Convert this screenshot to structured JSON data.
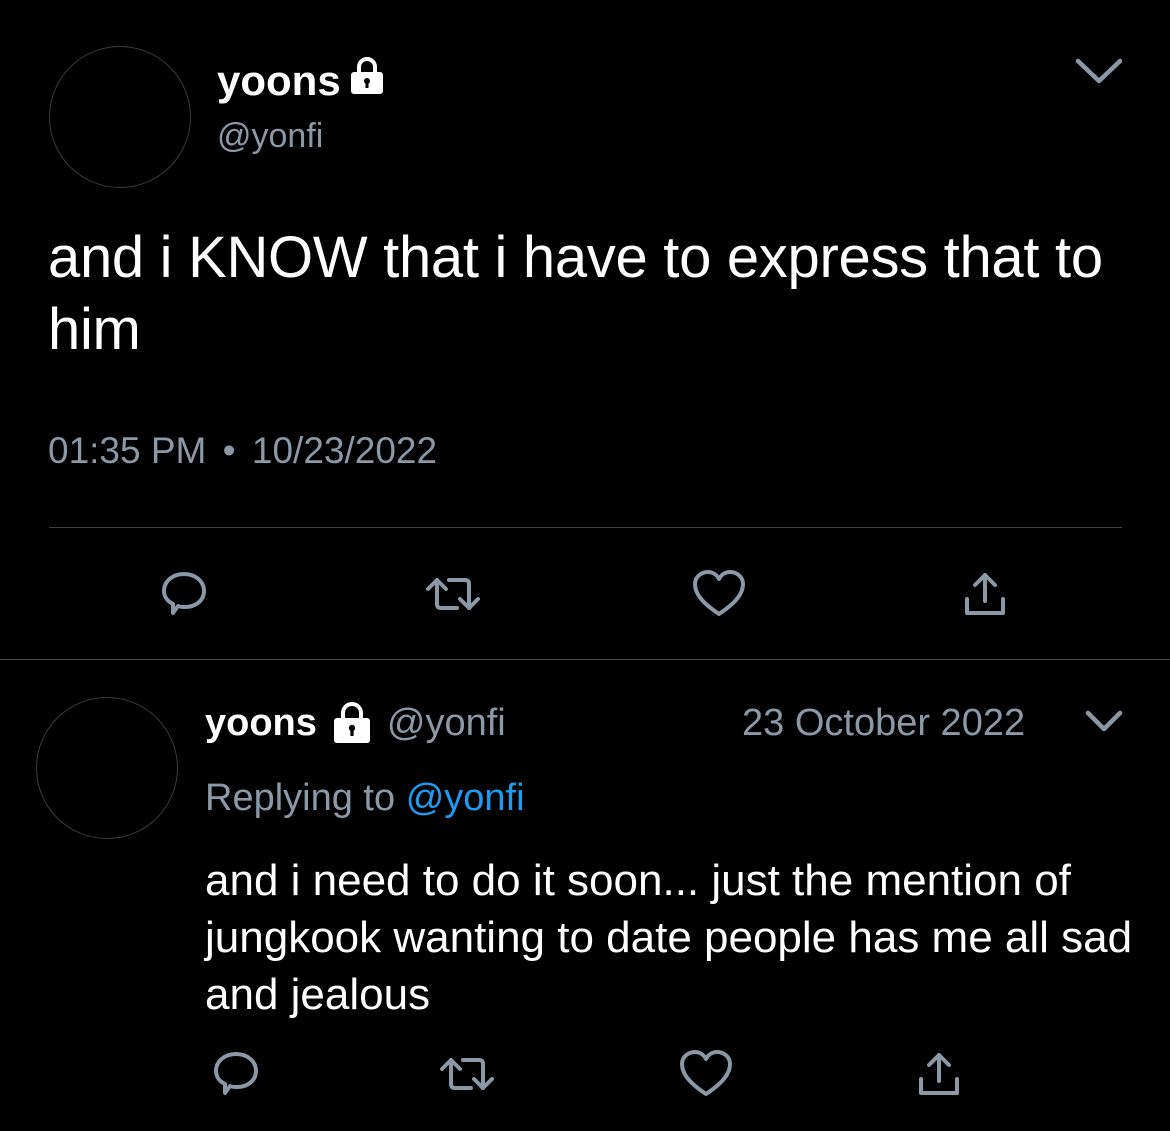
{
  "main_tweet": {
    "display_name": "yoons",
    "handle": "@yonfi",
    "text": "and i KNOW that i have to express that to him",
    "time": "01:35 PM",
    "separator": "•",
    "date": "10/23/2022",
    "icons": {
      "lock": "lock-icon",
      "caret": "chevron-down-icon",
      "reply": "reply-icon",
      "retweet": "retweet-icon",
      "like": "heart-icon",
      "share": "share-icon"
    }
  },
  "reply_tweet": {
    "display_name": "yoons",
    "handle": "@yonfi",
    "date": "23 October 2022",
    "replying_prefix": "Replying to",
    "replying_to": "@yonfi",
    "text": "and i need to do it soon... just the mention of jungkook wanting to date people has me all sad and jealous"
  },
  "colors": {
    "background": "#000000",
    "text_primary": "#ffffff",
    "text_secondary": "#8b98a5",
    "link": "#1d9bf0",
    "divider": "#3d4046"
  }
}
